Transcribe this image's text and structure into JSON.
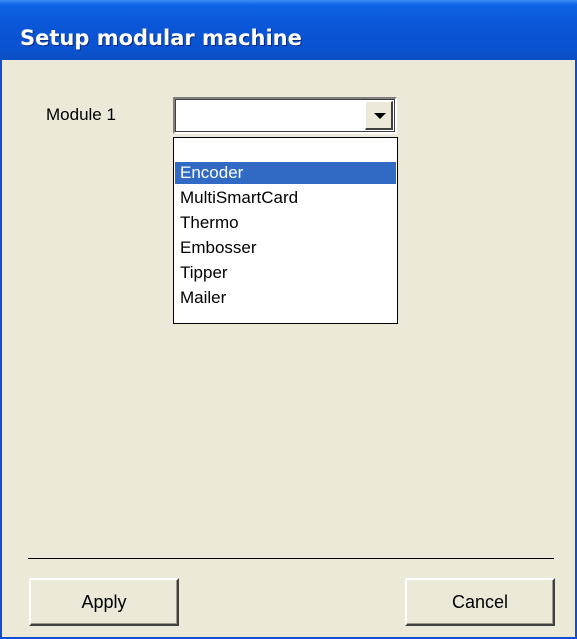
{
  "window": {
    "title": "Setup modular machine"
  },
  "form": {
    "module_label": "Module 1",
    "module_value": ""
  },
  "dropdown": {
    "items": [
      "",
      "Encoder",
      "MultiSmartCard",
      "Thermo",
      "Embosser",
      "Tipper",
      "Mailer"
    ],
    "selected": "Encoder"
  },
  "buttons": {
    "apply_label": "Apply",
    "cancel_label": "Cancel"
  },
  "colors": {
    "titlebar": "#0a57d8",
    "window_bg": "#ece9d8",
    "selection": "#316ac5"
  },
  "icons": {
    "combo_arrow": "chevron-down-icon"
  }
}
